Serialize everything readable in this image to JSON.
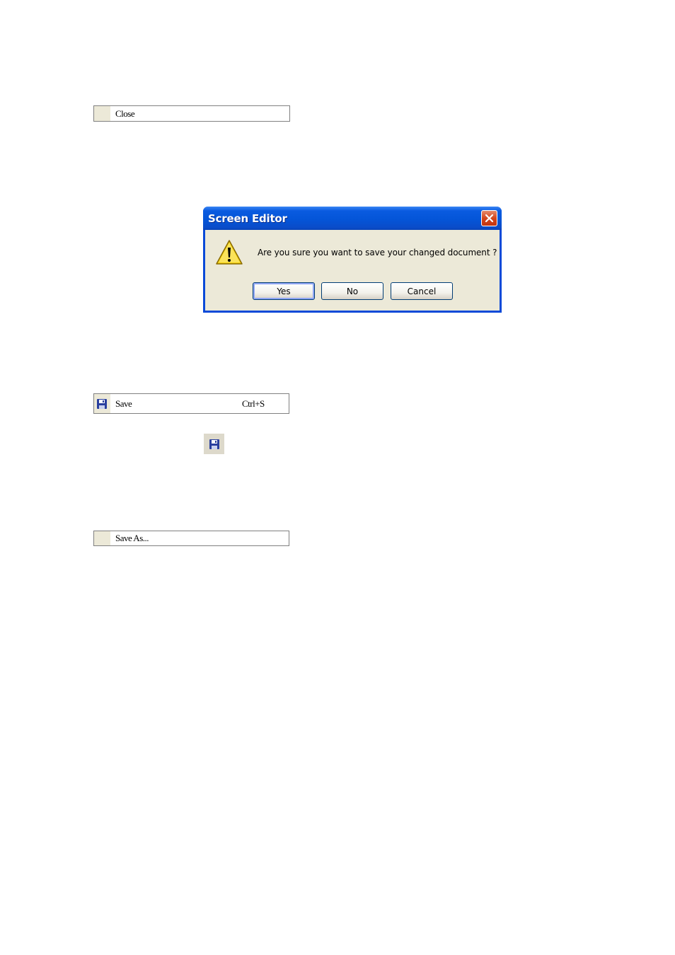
{
  "menu_close": {
    "label": "Close"
  },
  "dialog": {
    "title": "Screen Editor",
    "message": "Are you sure you want to save your changed document ?",
    "buttons": {
      "yes": "Yes",
      "no": "No",
      "cancel": "Cancel"
    },
    "icon": "warning-icon",
    "accent_color": "#0455d8",
    "body_color": "#ece9d8"
  },
  "menu_save": {
    "label": "Save",
    "shortcut": "Ctrl+S",
    "icon": "floppy-disk-icon"
  },
  "toolbar_save": {
    "icon": "floppy-disk-icon"
  },
  "menu_save_as": {
    "label": "Save As..."
  }
}
